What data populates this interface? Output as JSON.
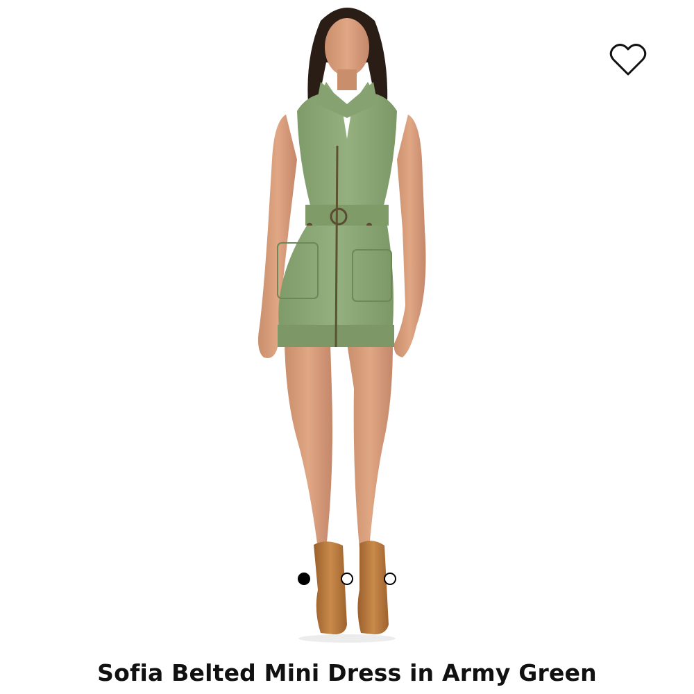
{
  "product": {
    "title": "Sofia Belted Mini Dress in Army Green",
    "image_alt": "Model wearing a sleeveless army green zip-front belted mini dress with tan ankle boots"
  },
  "wishlist": {
    "icon": "heart-outline-icon"
  },
  "carousel": {
    "total": 3,
    "active_index": 0
  },
  "colors": {
    "dress": "#8ea877",
    "boots": "#b87838",
    "accent": "#000000"
  }
}
